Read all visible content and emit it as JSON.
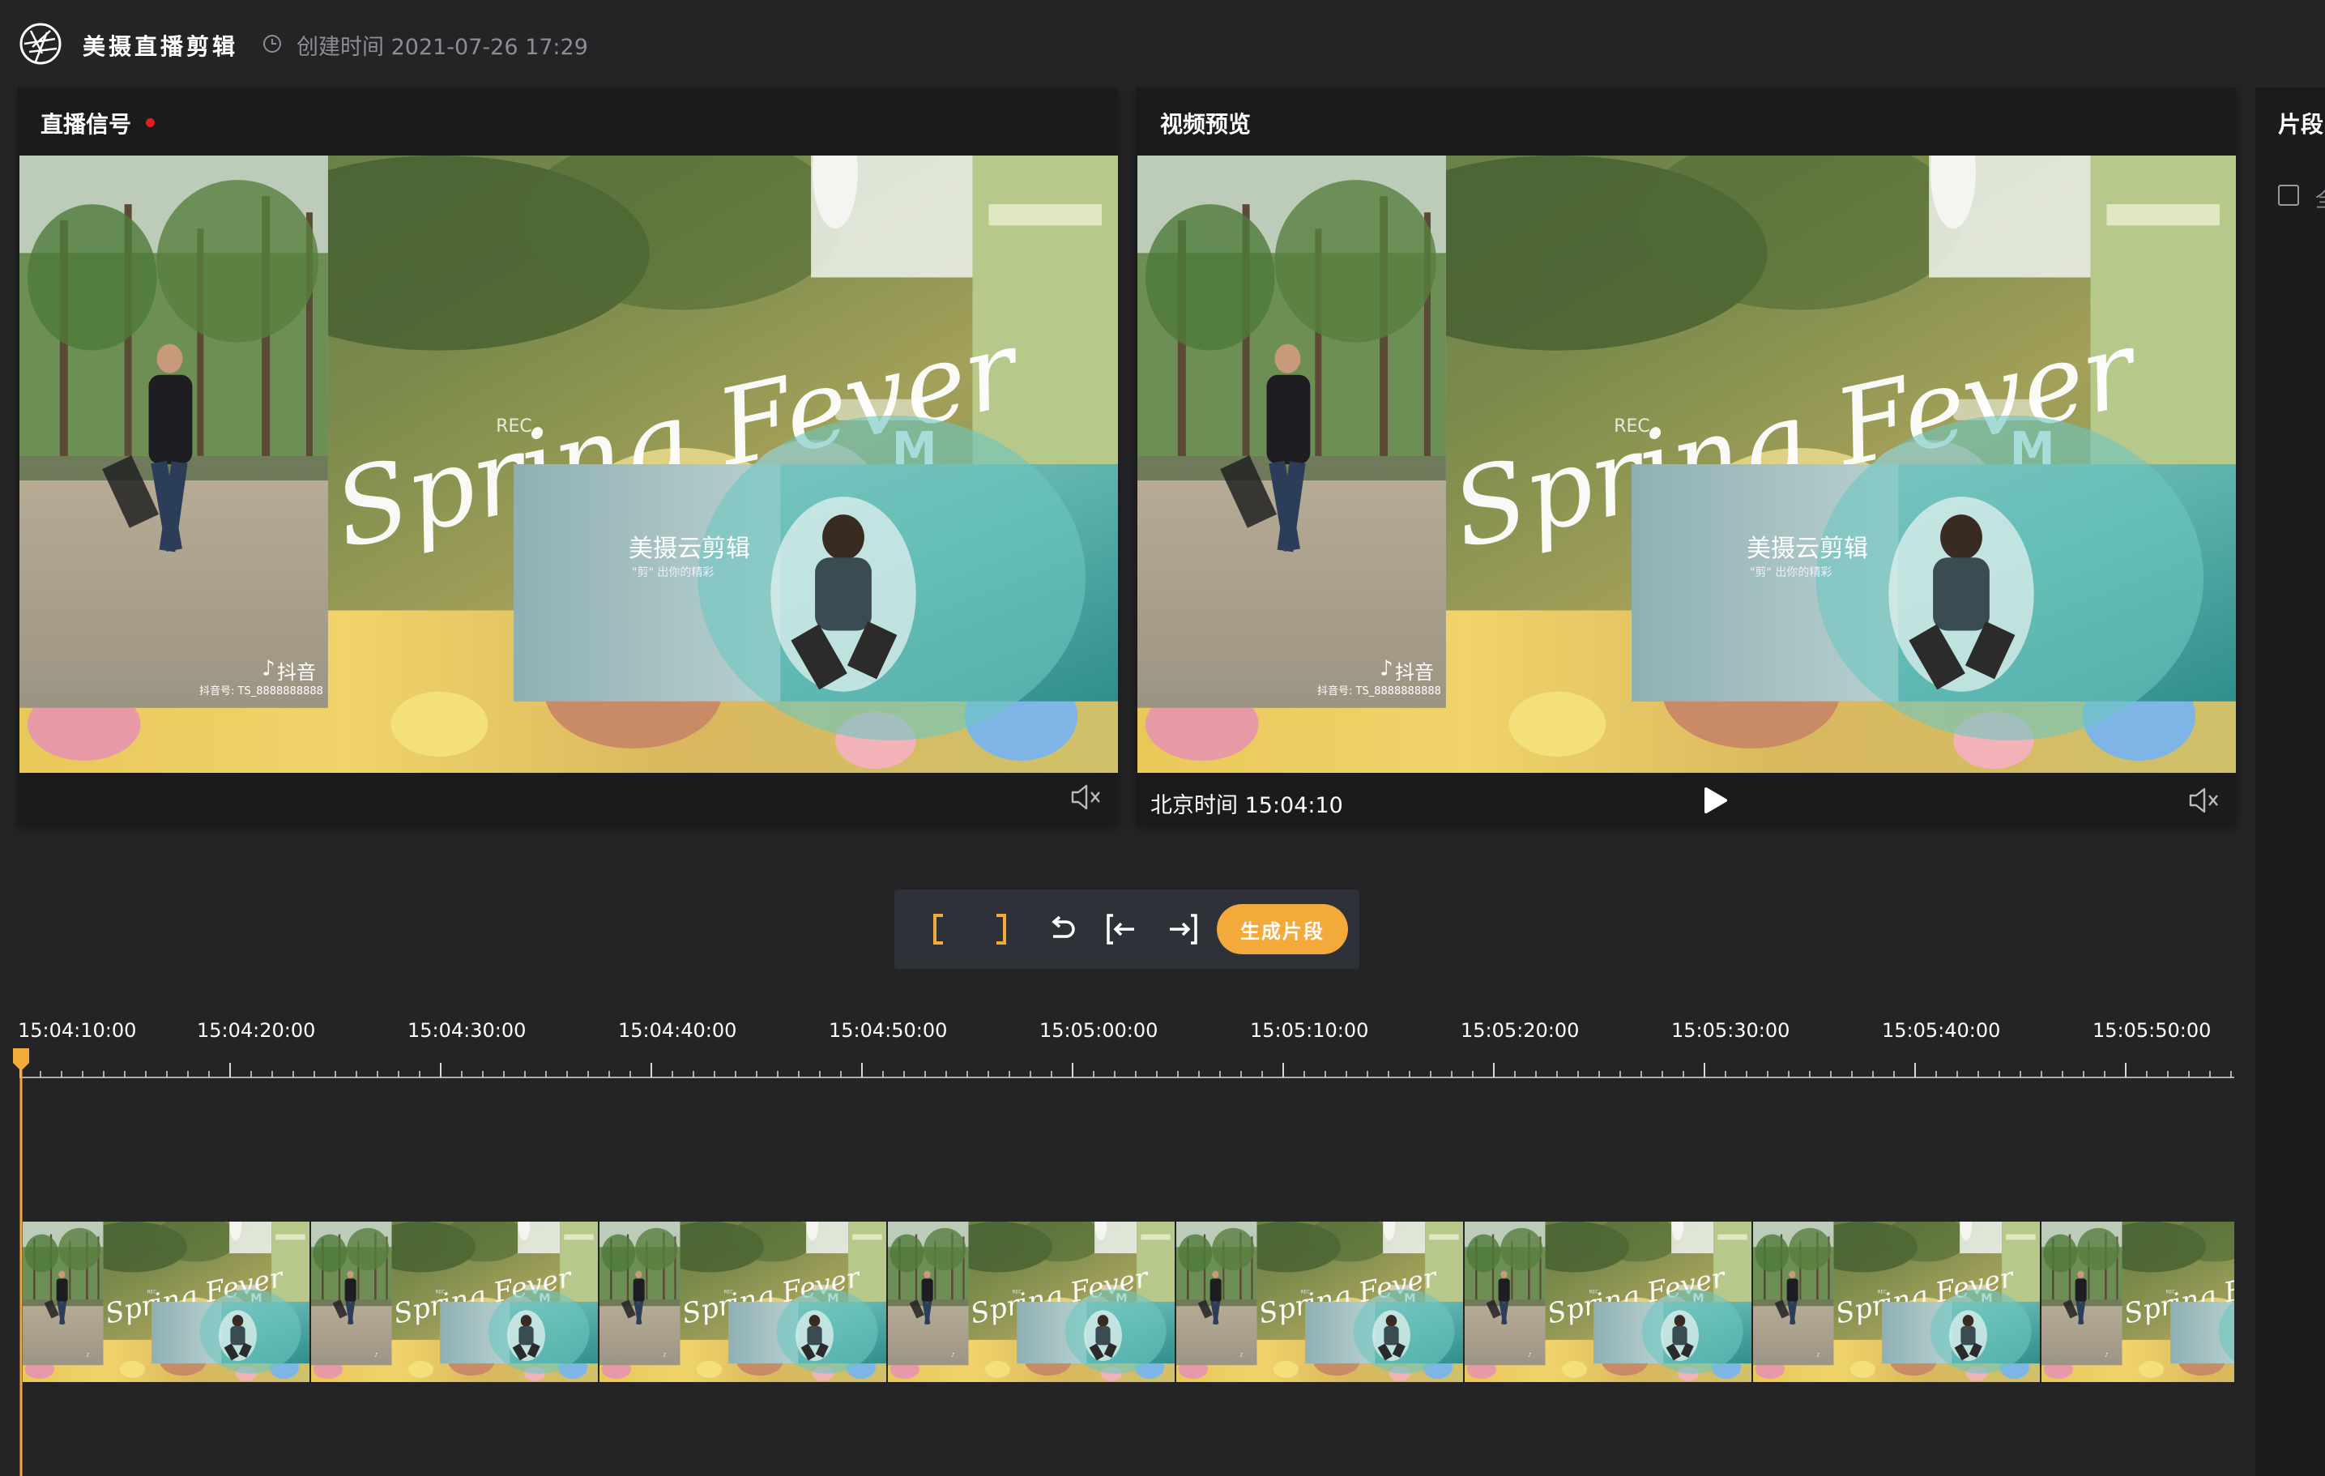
{
  "header": {
    "app_title": "美摄直播剪辑",
    "created_label": "创建时间 2021-07-26 17:29",
    "logo_icon": "aperture-logo-icon",
    "clock_icon": "clock-icon"
  },
  "live_panel": {
    "title": "直播信号",
    "live_indicator_color": "#e02020",
    "mute_icon": "volume-mute-icon",
    "pip_title": "美摄云剪辑",
    "pip_sub": "\"剪\" 出你的精彩",
    "douyin_label": "抖音",
    "douyin_id": "抖音号: TS_8888888888"
  },
  "preview_panel": {
    "title": "视频预览",
    "time_label": "北京时间 15:04:10",
    "play_icon": "play-icon",
    "mute_icon": "volume-mute-icon",
    "pip_title": "美摄云剪辑",
    "pip_sub": "\"剪\" 出你的精彩",
    "douyin_label": "抖音",
    "douyin_id": "抖音号: TS_8888888888"
  },
  "clips_panel": {
    "title": "片段",
    "select_all_label": "全"
  },
  "toolbar": {
    "mark_in_icon": "mark-in-bracket-icon",
    "mark_out_icon": "mark-out-bracket-icon",
    "undo_icon": "undo-icon",
    "jump_start_icon": "jump-to-start-icon",
    "jump_end_icon": "jump-to-end-icon",
    "generate_label": "生成片段",
    "accent_color": "#f4a93b"
  },
  "timeline": {
    "ticks": [
      "15:04:10:00",
      "15:04:20:00",
      "15:04:30:00",
      "15:04:40:00",
      "15:04:50:00",
      "15:05:00:00",
      "15:05:10:00",
      "15:05:20:00",
      "15:05:30:00",
      "15:05:40:00",
      "15:05:50:00"
    ],
    "playhead_color": "#f4a93b"
  }
}
